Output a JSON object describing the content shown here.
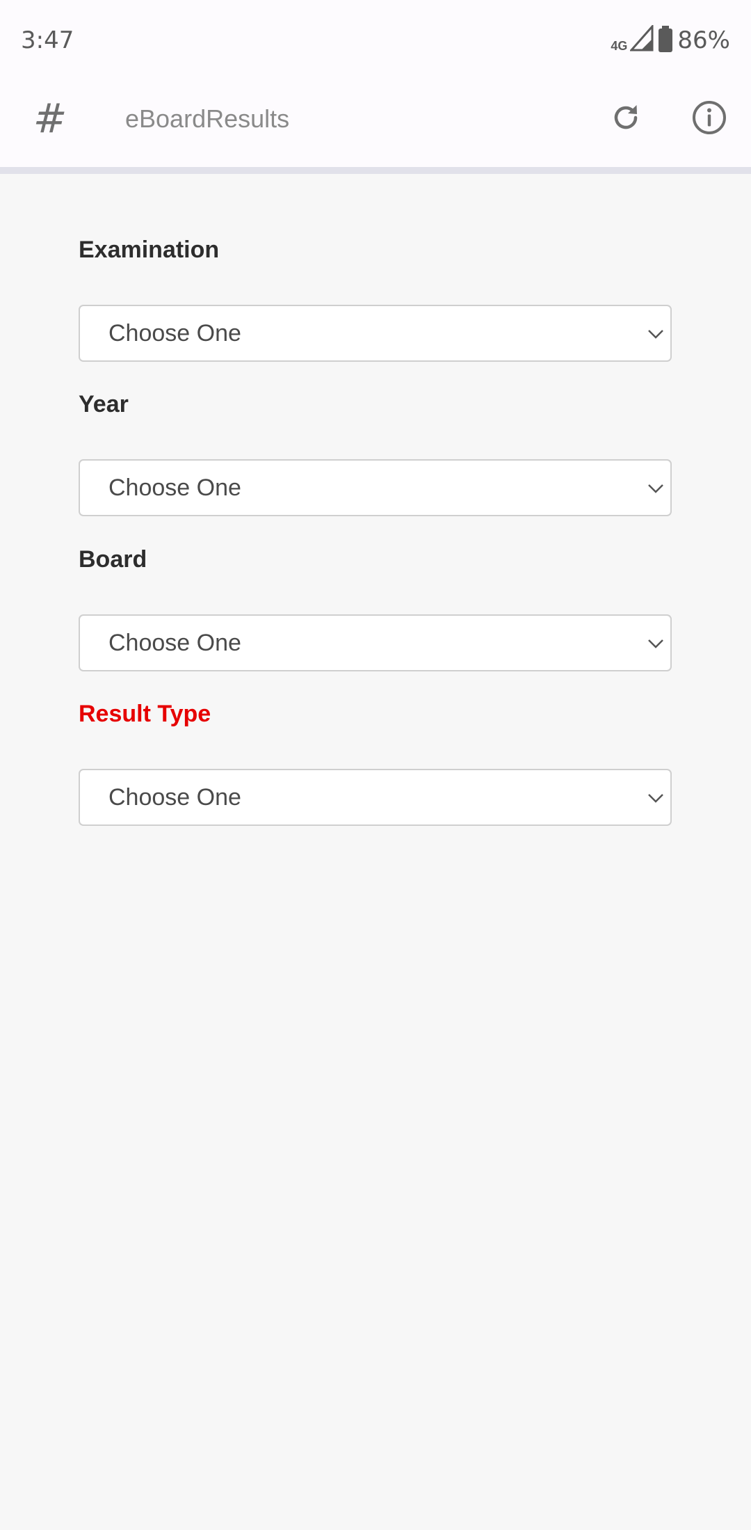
{
  "status_bar": {
    "time": "3:47",
    "network": "4G",
    "battery": "86%"
  },
  "app_bar": {
    "menu_glyph": "#",
    "title": "eBoardResults",
    "refresh_icon": "refresh-icon",
    "info_icon": "info-icon"
  },
  "form": {
    "fields": [
      {
        "label": "Examination",
        "value": "Choose One",
        "required": false
      },
      {
        "label": "Year",
        "value": "Choose One",
        "required": false
      },
      {
        "label": "Board",
        "value": "Choose One",
        "required": false
      },
      {
        "label": "Result Type",
        "value": "Choose One",
        "required": true
      }
    ]
  },
  "colors": {
    "required_label": "#e60000",
    "label": "#2d2d2d",
    "background": "#f7f7f7",
    "appbar": "#fdfbfe"
  }
}
